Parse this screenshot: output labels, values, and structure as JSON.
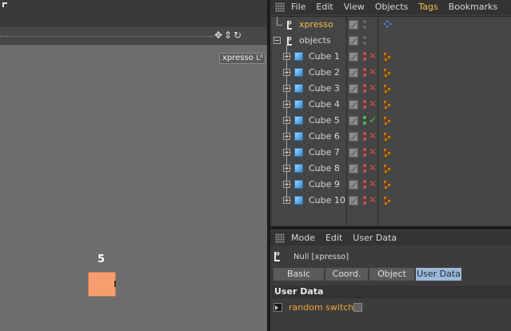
{
  "viewport": {
    "xpresso_tag_label": "xpresso",
    "xpresso_tag_icon": "null-object-icon",
    "cube_number": "5",
    "cube_color": "#f79e6f",
    "nav_icons": [
      "move-view-icon",
      "zoom-view-icon",
      "rotate-view-icon",
      "maximize-view-icon"
    ]
  },
  "object_manager": {
    "menu": [
      "File",
      "Edit",
      "View",
      "Objects",
      "Tags",
      "Bookmarks"
    ],
    "active_menu": "Tags",
    "rows": [
      {
        "name": "xpresso",
        "type": "null",
        "selected": true,
        "status": "none",
        "tag": "xpresso-tag-icon"
      },
      {
        "name": "objects",
        "type": "null",
        "selected": false,
        "status": "none",
        "tag": ""
      },
      {
        "name": "Cube 1",
        "type": "cube",
        "status": "disabled",
        "tag": "texture-tag-icon"
      },
      {
        "name": "Cube 2",
        "type": "cube",
        "status": "disabled",
        "tag": "texture-tag-icon"
      },
      {
        "name": "Cube 3",
        "type": "cube",
        "status": "disabled",
        "tag": "texture-tag-icon"
      },
      {
        "name": "Cube 4",
        "type": "cube",
        "status": "disabled",
        "tag": "texture-tag-icon"
      },
      {
        "name": "Cube 5",
        "type": "cube",
        "status": "enabled",
        "tag": "texture-tag-icon"
      },
      {
        "name": "Cube 6",
        "type": "cube",
        "status": "disabled",
        "tag": "texture-tag-icon"
      },
      {
        "name": "Cube 7",
        "type": "cube",
        "status": "disabled",
        "tag": "texture-tag-icon"
      },
      {
        "name": "Cube 8",
        "type": "cube",
        "status": "disabled",
        "tag": "texture-tag-icon"
      },
      {
        "name": "Cube 9",
        "type": "cube",
        "status": "disabled",
        "tag": "texture-tag-icon"
      },
      {
        "name": "Cube 10",
        "type": "cube",
        "status": "disabled",
        "tag": "texture-tag-icon"
      }
    ],
    "colors": {
      "selected_text": "#f3c04a",
      "enabled": "#3ecb49",
      "disabled": "#e04a4a"
    }
  },
  "attribute_manager": {
    "menu": [
      "Mode",
      "Edit",
      "User Data"
    ],
    "title": "Null [xpresso]",
    "tabs": [
      "Basic",
      "Coord.",
      "Object",
      "User Data"
    ],
    "active_tab": "User Data",
    "section": "User Data",
    "param_label": "random switch",
    "param_checked": false
  }
}
